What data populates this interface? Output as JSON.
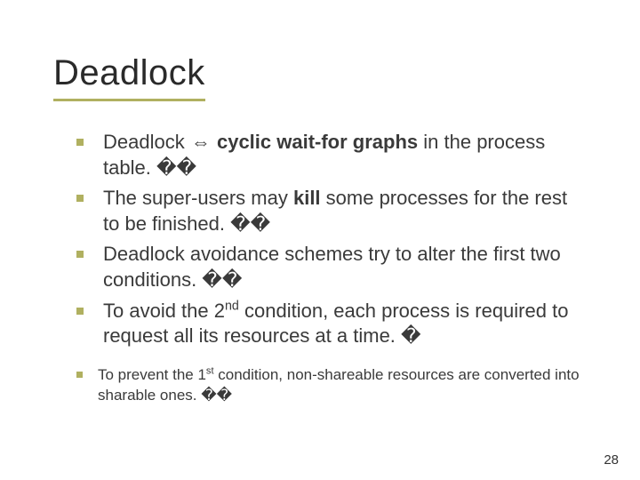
{
  "title": "Deadlock",
  "bullets": {
    "b1": {
      "pre": "Deadlock ",
      "boldpart": "cyclic wait-for graphs",
      "post": " in the process table. ",
      "tail": "��"
    },
    "b2": {
      "pre": "The super-users may ",
      "bold": "kill",
      "post": " some processes for the rest to be finished. ",
      "tail": "��"
    },
    "b3": {
      "text": "Deadlock avoidance schemes try to alter the first two conditions. ",
      "tail": "��"
    },
    "b4": {
      "pre": "To avoid the 2",
      "ord": "nd",
      "post": " condition, each process is required to request all its resources at a time. ",
      "tail": "�"
    },
    "s1": {
      "pre": "To prevent the 1",
      "ord": "st",
      "post": " condition, non-shareable resources are converted into sharable ones. ",
      "tail": "��"
    }
  },
  "page_number": "28"
}
